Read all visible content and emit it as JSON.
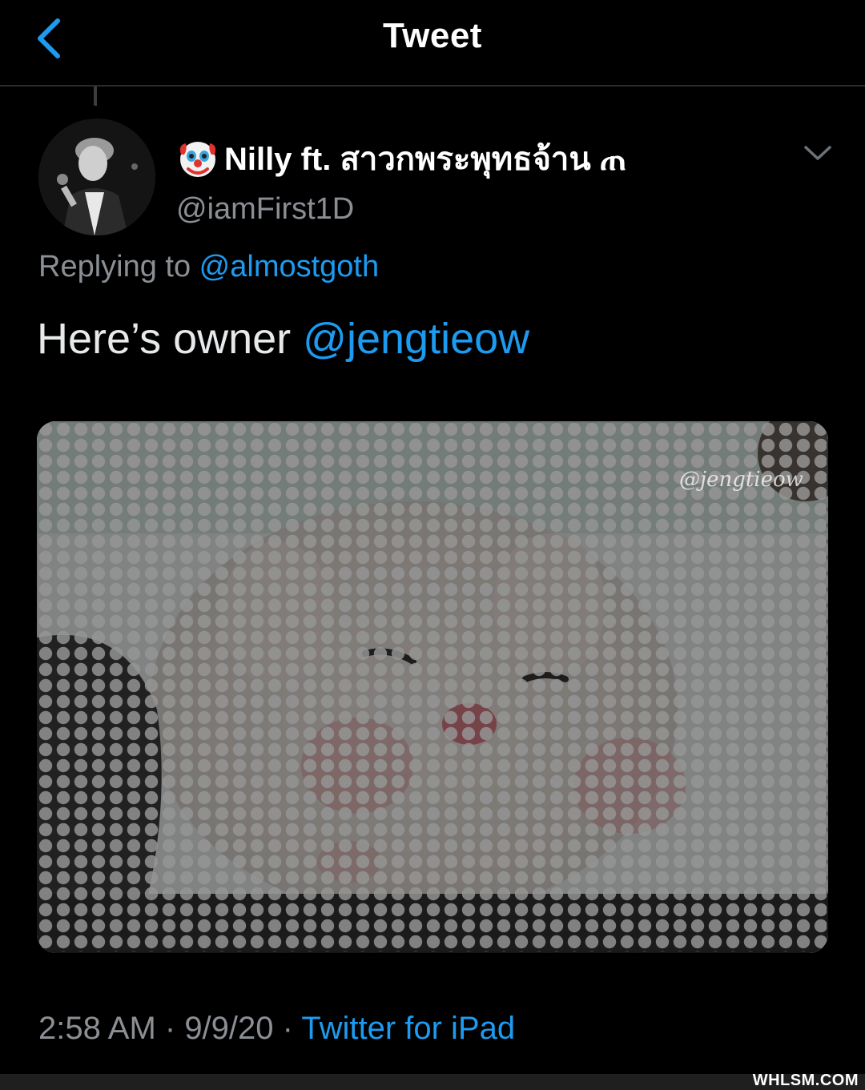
{
  "header": {
    "title": "Tweet",
    "back_icon": "chevron-left-icon",
    "accent": "#1d9bf0"
  },
  "author": {
    "emoji": "clown-face-icon",
    "display_name": "Nilly ft. สาวกพระพุทธจ้าน ጠ",
    "handle": "@iamFirst1D",
    "avatar": "avatar-photo"
  },
  "reply": {
    "prefix": "Replying to ",
    "mention": "@almostgoth"
  },
  "tweet": {
    "text": "Here’s owner ",
    "mention": "@jengtieow"
  },
  "media": {
    "photo_watermark": "@jengtieow"
  },
  "footer": {
    "time": "2:58 AM",
    "separator": " · ",
    "date": "9/9/20",
    "source": "Twitter for iPad"
  },
  "site_watermark": "WHLSM.COM"
}
